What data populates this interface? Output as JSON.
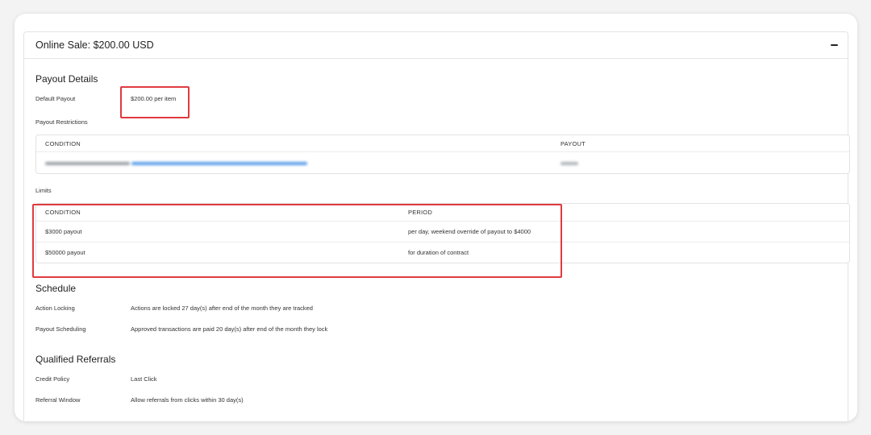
{
  "panel": {
    "title": "Online Sale: $200.00 USD",
    "collapse_icon": "minus-icon"
  },
  "payout_details": {
    "title": "Payout Details",
    "default_payout_label": "Default Payout",
    "default_payout_value": "$200.00 per item",
    "restrictions_label": "Payout Restrictions",
    "restrictions_table": {
      "headers": [
        "CONDITION",
        "PAYOUT"
      ]
    }
  },
  "limits": {
    "label": "Limits",
    "headers": [
      "CONDITION",
      "PERIOD"
    ],
    "rows": [
      {
        "condition": "$3000 payout",
        "period": "per day, weekend override of payout to $4000"
      },
      {
        "condition": "$50000 payout",
        "period": "for duration of contract"
      }
    ]
  },
  "schedule": {
    "title": "Schedule",
    "action_locking_label": "Action Locking",
    "action_locking_value": "Actions are locked 27 day(s) after end of the month they are tracked",
    "payout_scheduling_label": "Payout Scheduling",
    "payout_scheduling_value": "Approved transactions are paid 20 day(s) after end of the month they lock"
  },
  "qualified_referrals": {
    "title": "Qualified Referrals",
    "credit_policy_label": "Credit Policy",
    "credit_policy_value": "Last Click",
    "referral_window_label": "Referral Window",
    "referral_window_value": "Allow referrals from clicks within 30 day(s)"
  },
  "colors": {
    "highlight": "#e03a3e",
    "link_blurred": "#4a90e2"
  }
}
